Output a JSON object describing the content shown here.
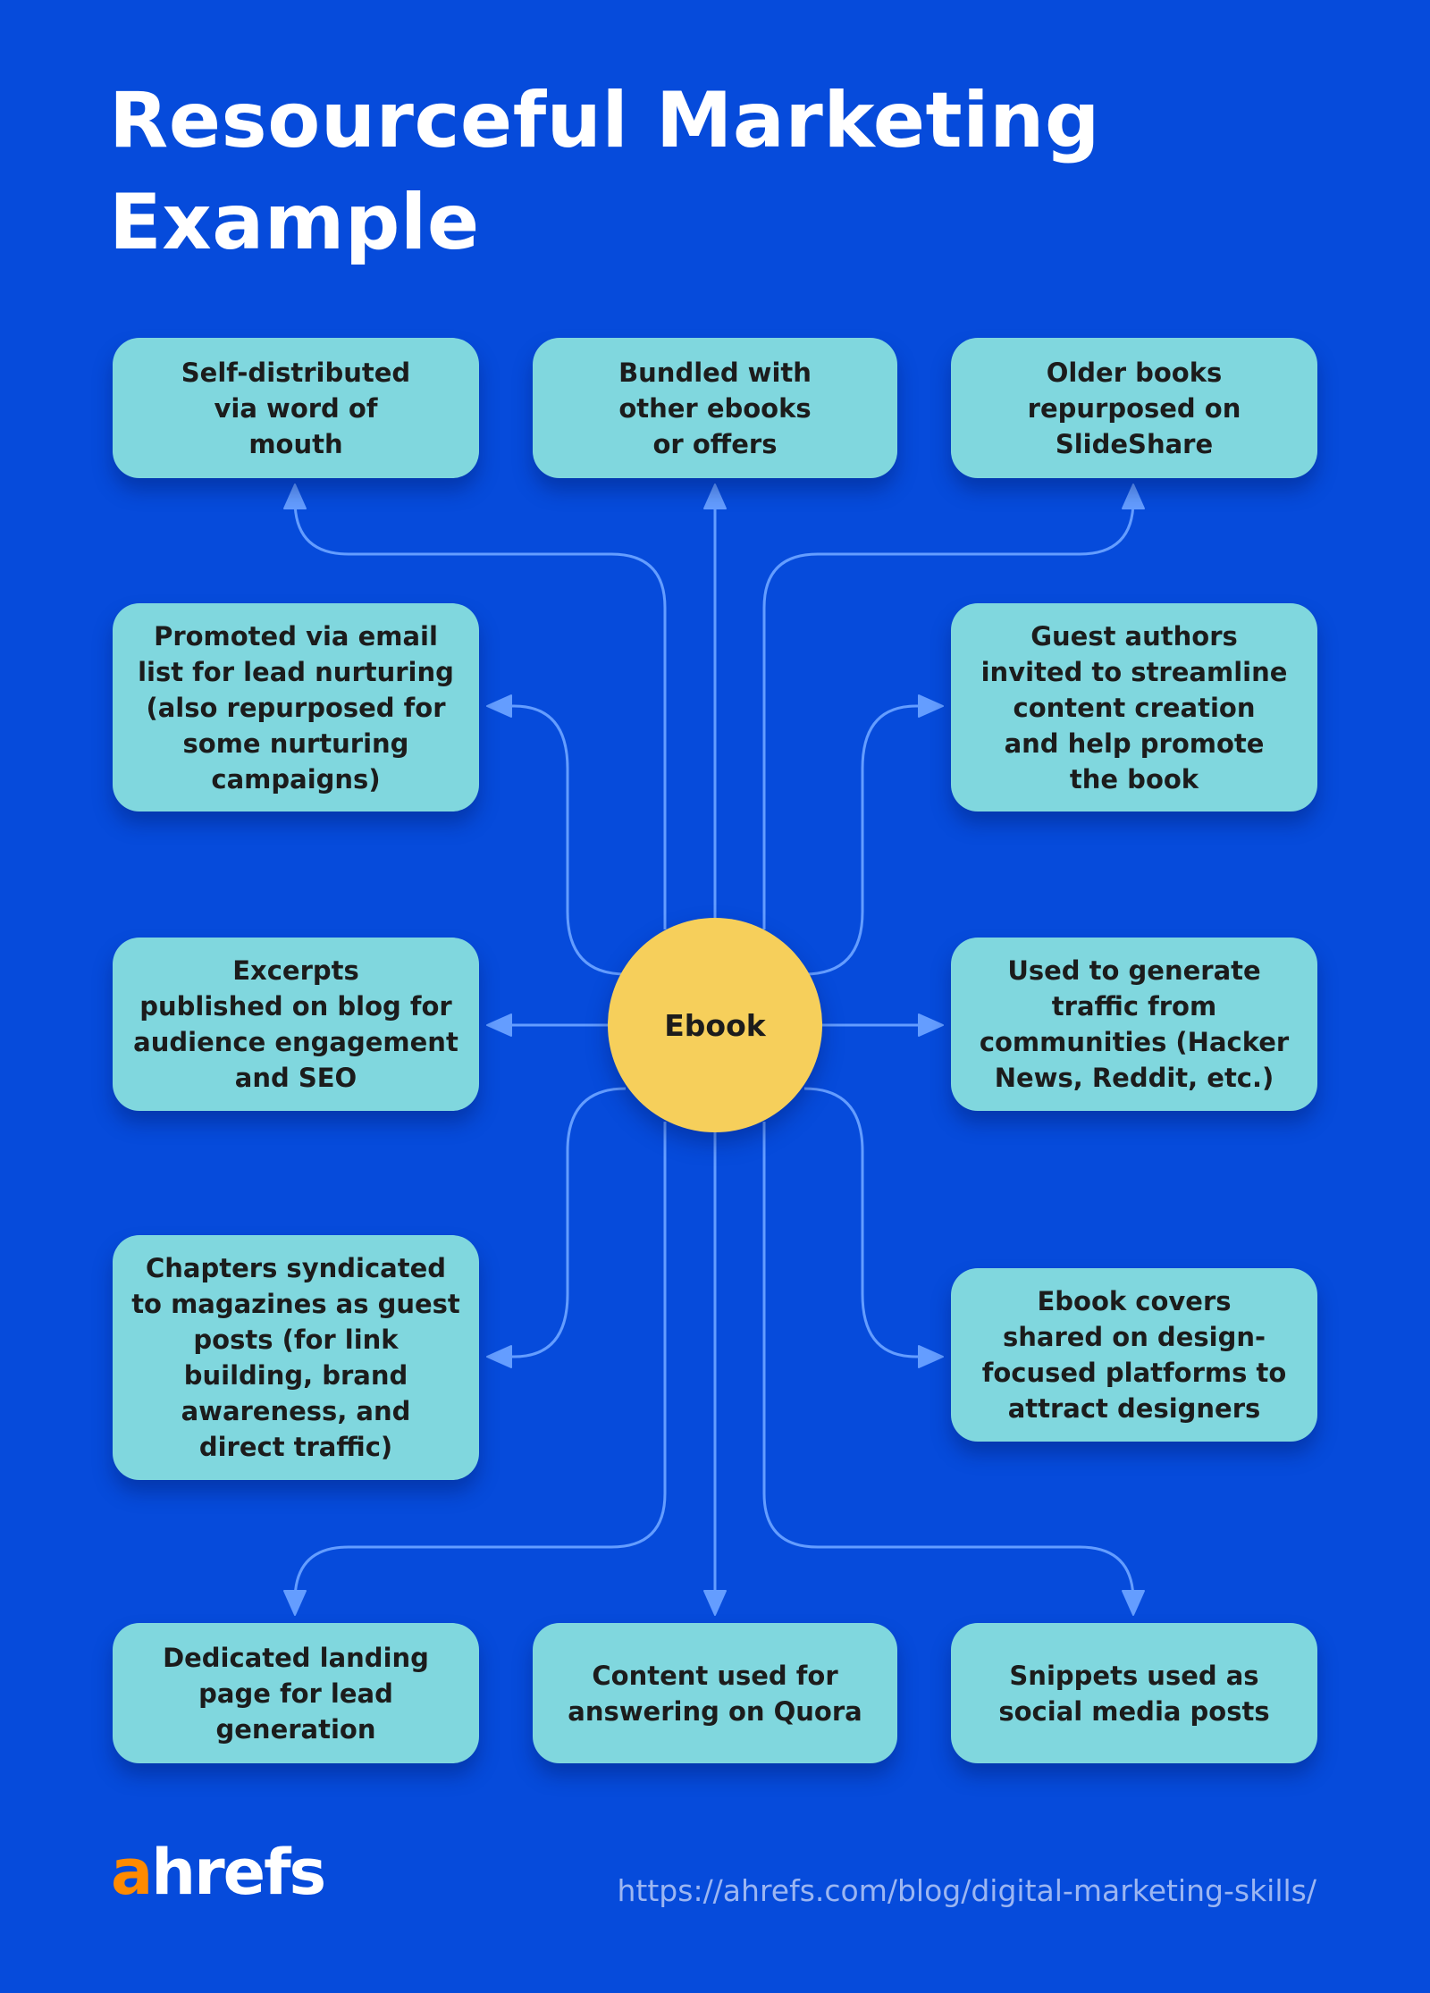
{
  "title": {
    "line1": "Resourceful Marketing",
    "line2": "Example"
  },
  "center_node": {
    "label": "Ebook"
  },
  "nodes": {
    "top_left": {
      "lines": [
        "Self-distributed",
        "via word of",
        "mouth"
      ]
    },
    "top_middle": {
      "lines": [
        "Bundled with",
        "other ebooks",
        "or offers"
      ]
    },
    "top_right": {
      "lines": [
        "Older books",
        "repurposed on",
        "SlideShare"
      ]
    },
    "upper_left": {
      "lines": [
        "Promoted via email",
        "list for lead nurturing",
        "(also repurposed for",
        "some nurturing",
        "campaigns)"
      ]
    },
    "upper_right": {
      "lines": [
        "Guest authors",
        "invited to streamline",
        "content creation",
        "and help promote",
        "the book"
      ]
    },
    "middle_left": {
      "lines": [
        "Excerpts",
        "published on blog for",
        "audience engagement",
        "and SEO"
      ]
    },
    "middle_right": {
      "lines": [
        "Used to generate",
        "traffic from",
        "communities (Hacker",
        "News, Reddit, etc.)"
      ]
    },
    "lower_left": {
      "lines": [
        "Chapters syndicated",
        "to magazines as guest",
        "posts (for link",
        "building, brand",
        "awareness, and",
        "direct traffic)"
      ]
    },
    "lower_right": {
      "lines": [
        "Ebook covers",
        "shared on design-",
        "focused platforms to",
        "attract designers"
      ]
    },
    "bottom_left": {
      "lines": [
        "Dedicated landing",
        "page for lead",
        "generation"
      ]
    },
    "bottom_middle": {
      "lines": [
        "Content used for",
        "answering on Quora"
      ]
    },
    "bottom_right": {
      "lines": [
        "Snippets used as",
        "social media posts"
      ]
    }
  },
  "footer": {
    "logo_accent": "a",
    "logo_rest": "hrefs",
    "url": "https://ahrefs.com/blog/digital-marketing-skills/"
  },
  "colors": {
    "background": "#064BDB",
    "node_fill": "#80D7DE",
    "hub_fill": "#F6CF5B",
    "connector": "#649DFF",
    "logo_accent": "#FF8A00",
    "url_text": "#9CB6F2"
  }
}
